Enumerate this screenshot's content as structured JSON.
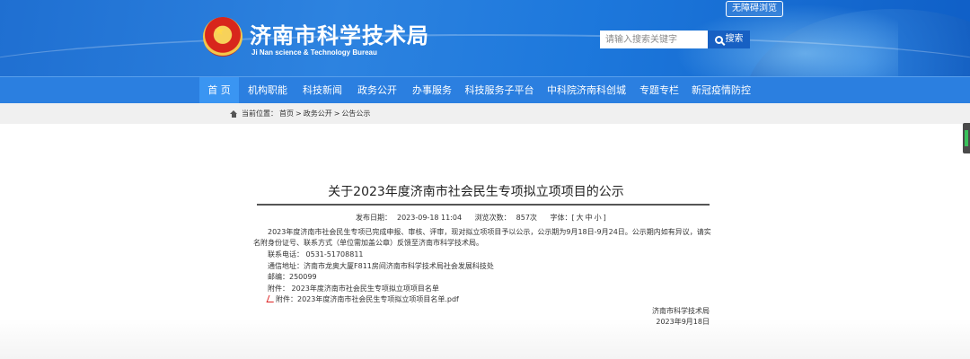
{
  "header": {
    "site_title": "济南市科学技术局",
    "site_subtitle": "Ji Nan science & Technology Bureau",
    "accessibility_label": "无障碍浏览",
    "search": {
      "placeholder": "请输入搜索关键字",
      "button_label": "搜索"
    }
  },
  "nav": {
    "items": [
      {
        "label": "首 页",
        "active": true
      },
      {
        "label": "机构职能"
      },
      {
        "label": "科技新闻"
      },
      {
        "label": "政务公开"
      },
      {
        "label": "办事服务"
      },
      {
        "label": "科技服务子平台"
      },
      {
        "label": "中科院济南科创城"
      },
      {
        "label": "专题专栏"
      },
      {
        "label": "新冠疫情防控"
      }
    ]
  },
  "breadcrumb": {
    "prefix": "当前位置：",
    "items": [
      "首页",
      "政务公开",
      "公告公示"
    ],
    "separator": " > "
  },
  "article": {
    "title": "关于2023年度济南市社会民生专项拟立项项目的公示",
    "meta": {
      "publish_label": "发布日期：",
      "publish_date": "2023-09-18 11:04",
      "views_label": "浏览次数：",
      "views": "857次",
      "font_label": "字体：[",
      "font_large": "大",
      "font_medium": "中",
      "font_small": "小",
      "font_close": "]"
    },
    "paragraph": "2023年度济南市社会民生专项已完成申报、审核、评审，现对拟立项项目予以公示，公示期为9月18日-9月24日。公示期内如有异议，请实名附身份证号、联系方式（单位需加盖公章）反馈至济南市科学技术局。",
    "phone": "联系电话： 0531-51708811",
    "address": "通信地址：济南市龙奥大厦F811房间济南市科学技术局社会发展科技处",
    "postcode": "邮编：250099",
    "attachment_text": "附件： 2023年度济南市社会民生专项拟立项项目名单",
    "attachment_link": "附件：2023年度济南市社会民生专项拟立项项目名单.pdf",
    "signature": "济南市科学技术局",
    "sign_date": "2023年9月18日"
  },
  "colors": {
    "header_blue": "#1f6fd1",
    "nav_blue": "#2b7fe0",
    "nav_active": "#3a95f2",
    "search_button": "#1760c3"
  }
}
